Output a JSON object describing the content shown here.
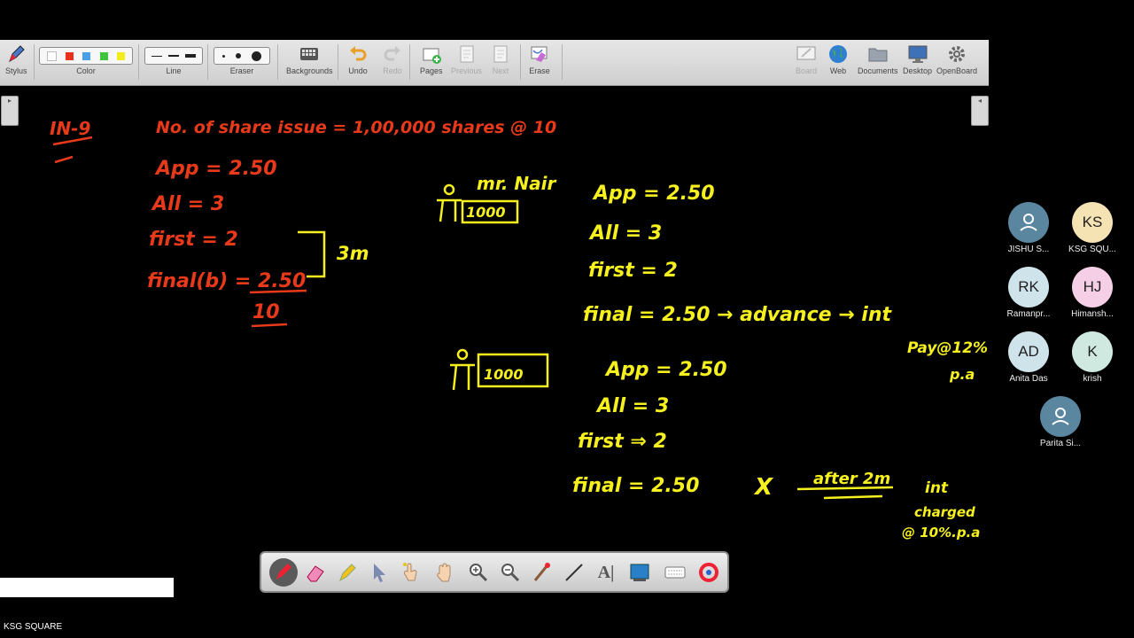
{
  "toolbar": {
    "stylus": "Stylus",
    "color": "Color",
    "line": "Line",
    "eraser": "Eraser",
    "backgrounds": "Backgrounds",
    "undo": "Undo",
    "redo": "Redo",
    "pages": "Pages",
    "previous": "Previous",
    "next": "Next",
    "erase": "Erase",
    "board": "Board",
    "web": "Web",
    "documents": "Documents",
    "desktop": "Desktop",
    "openboard": "OpenBoard"
  },
  "colors": {
    "swatches": [
      "#ffffff",
      "#e8321c",
      "#4aa0e8",
      "#3fc43f",
      "#f2ec1c"
    ],
    "ink_red": "#e83a1a",
    "ink_yellow": "#f5f01e"
  },
  "board": {
    "red": {
      "label": "IN-9",
      "issue_line": "No. of share issue = 1,00,000 shares @ 10",
      "app": "App = 2.50",
      "all": "All = 3",
      "first": "first = 2",
      "final": "final(b) = 2.50",
      "bracket_note": "3m",
      "total": "10"
    },
    "yellow": {
      "holder1_name": "mr. Nair",
      "holder1_shares": "1000",
      "h1_app": "App = 2.50",
      "h1_all": "All = 3",
      "h1_first": "first = 2",
      "h1_final": "final = 2.50 → advance → int",
      "h1_note1": "Pay@12%",
      "h1_note2": "p.a",
      "holder2_shares": "1000",
      "h2_app": "App = 2.50",
      "h2_all": "All = 3",
      "h2_first": "first ⇒ 2",
      "h2_final_left": "final = 2.50",
      "h2_cross": "X",
      "h2_after": "after 2m",
      "h2_note1": "int",
      "h2_note2": "charged",
      "h2_note3": "@ 10%.p.a"
    }
  },
  "participants": [
    {
      "initials": "",
      "name": "JISHU S...",
      "bg": "#5b86a0",
      "icon": "person-icon"
    },
    {
      "initials": "KS",
      "name": "KSG SQU...",
      "bg": "#f6e3b4"
    },
    {
      "initials": "RK",
      "name": "Ramanpr...",
      "bg": "#cfe3ea"
    },
    {
      "initials": "HJ",
      "name": "Himansh...",
      "bg": "#f4cfe6"
    },
    {
      "initials": "AD",
      "name": "Anita Das",
      "bg": "#cfe3ea"
    },
    {
      "initials": "K",
      "name": "krish",
      "bg": "#cfe9e1"
    },
    {
      "initials": "",
      "name": "Parita Si...",
      "bg": "#5b86a0",
      "icon": "person-icon"
    }
  ],
  "footer": {
    "label": "KSG SQUARE"
  }
}
